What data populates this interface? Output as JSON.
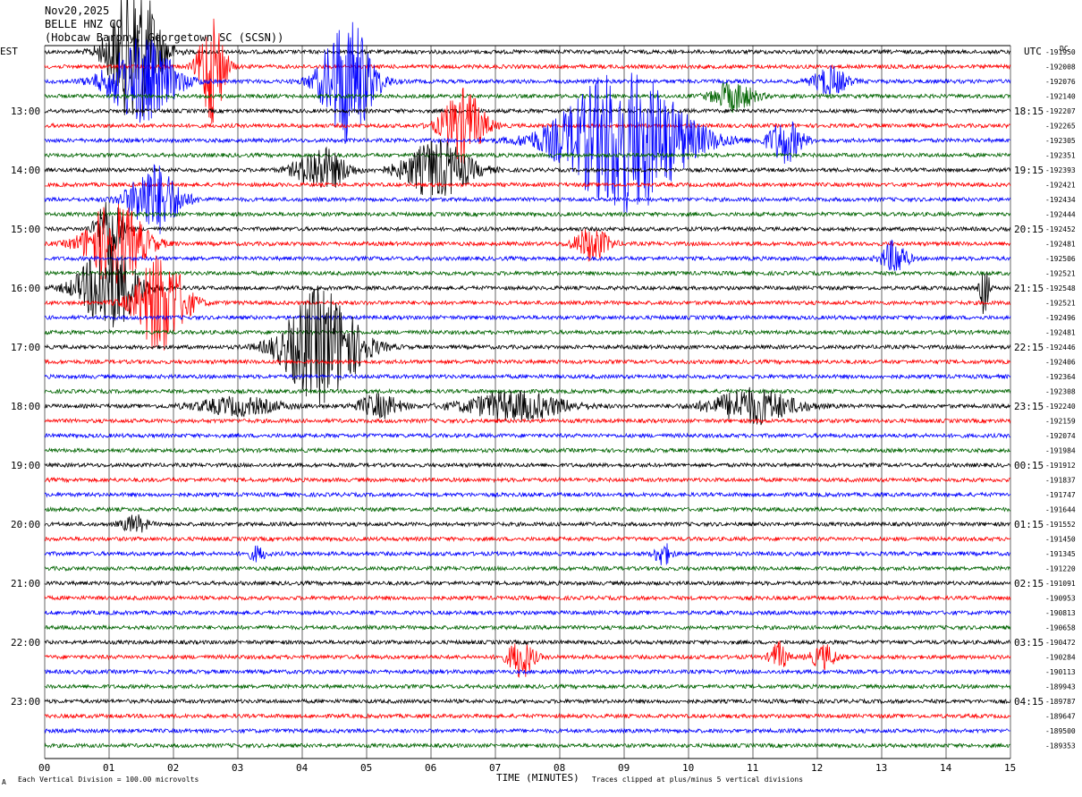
{
  "header": {
    "date": "Nov20,2025",
    "station": "BELLE HNZ CO",
    "location": "(Hobcaw Barony, Georgetown SC (SCSN))",
    "left_tz": "EST",
    "right_tz": "UTC",
    "dc_label": "DC"
  },
  "footer": {
    "scale_note": "Each Vertical Division =  100.00 microvolts",
    "clip_note": "Traces clipped at plus/minus 5 vertical divisions",
    "corner_mark": "A"
  },
  "chart_data": {
    "type": "line",
    "xlabel": "TIME (MINUTES)",
    "xlim": [
      0,
      15
    ],
    "x_ticks": [
      "00",
      "01",
      "02",
      "03",
      "04",
      "05",
      "06",
      "07",
      "08",
      "09",
      "10",
      "11",
      "12",
      "13",
      "14",
      "15"
    ],
    "trace_colors": [
      "#000000",
      "#ff0000",
      "#0000ff",
      "#006400"
    ],
    "trace_count": 48,
    "left_hour_labels": [
      "13:00",
      "14:00",
      "15:00",
      "16:00",
      "17:00",
      "18:00",
      "19:00",
      "20:00",
      "21:00",
      "22:00",
      "23:00"
    ],
    "right_hour_labels": [
      "18:15",
      "19:15",
      "20:15",
      "21:15",
      "22:15",
      "23:15",
      "00:15",
      "01:15",
      "02:15",
      "03:15",
      "04:15"
    ],
    "dc_offsets": [
      "-191950",
      "-192008",
      "-192076",
      "-192140",
      "-192207",
      "-192265",
      "-192305",
      "-192351",
      "-192393",
      "-192421",
      "-192434",
      "-192444",
      "-192452",
      "-192481",
      "-192506",
      "-192521",
      "-192548",
      "-192521",
      "-192496",
      "-192481",
      "-192446",
      "-192406",
      "-192364",
      "-192308",
      "-192240",
      "-192159",
      "-192074",
      "-191984",
      "-191912",
      "-191837",
      "-191747",
      "-191644",
      "-191552",
      "-191450",
      "-191345",
      "-191220",
      "-191091",
      "-190953",
      "-190813",
      "-190658",
      "-190472",
      "-190284",
      "-190113",
      "-189943",
      "-189787",
      "-189647",
      "-189500",
      "-189353"
    ],
    "events": [
      {
        "trace": 0,
        "minute": 1.4,
        "amp": 5.0,
        "dur": 0.6
      },
      {
        "trace": 1,
        "minute": 2.6,
        "amp": 4.0,
        "dur": 0.3
      },
      {
        "trace": 2,
        "minute": 1.5,
        "amp": 3.0,
        "dur": 0.8
      },
      {
        "trace": 2,
        "minute": 4.7,
        "amp": 4.5,
        "dur": 0.6
      },
      {
        "trace": 2,
        "minute": 12.2,
        "amp": 1.0,
        "dur": 0.4
      },
      {
        "trace": 3,
        "minute": 10.7,
        "amp": 1.0,
        "dur": 0.5
      },
      {
        "trace": 5,
        "minute": 6.5,
        "amp": 2.5,
        "dur": 0.5
      },
      {
        "trace": 6,
        "minute": 9.0,
        "amp": 5.0,
        "dur": 1.5
      },
      {
        "trace": 6,
        "minute": 11.5,
        "amp": 1.5,
        "dur": 0.4
      },
      {
        "trace": 8,
        "minute": 4.3,
        "amp": 1.5,
        "dur": 0.6
      },
      {
        "trace": 8,
        "minute": 6.1,
        "amp": 2.0,
        "dur": 0.8
      },
      {
        "trace": 10,
        "minute": 1.7,
        "amp": 2.5,
        "dur": 0.6
      },
      {
        "trace": 12,
        "minute": 1.0,
        "amp": 2.5,
        "dur": 0.3
      },
      {
        "trace": 13,
        "minute": 1.1,
        "amp": 3.0,
        "dur": 0.7
      },
      {
        "trace": 13,
        "minute": 8.5,
        "amp": 1.2,
        "dur": 0.4
      },
      {
        "trace": 14,
        "minute": 13.2,
        "amp": 1.2,
        "dur": 0.3
      },
      {
        "trace": 16,
        "minute": 1.0,
        "amp": 3.0,
        "dur": 0.7
      },
      {
        "trace": 16,
        "minute": 14.6,
        "amp": 2.0,
        "dur": 0.1
      },
      {
        "trace": 17,
        "minute": 1.8,
        "amp": 3.5,
        "dur": 0.6
      },
      {
        "trace": 20,
        "minute": 4.3,
        "amp": 4.0,
        "dur": 0.9
      },
      {
        "trace": 24,
        "minute": 3.0,
        "amp": 0.6,
        "dur": 1.0
      },
      {
        "trace": 24,
        "minute": 5.2,
        "amp": 0.8,
        "dur": 0.5
      },
      {
        "trace": 24,
        "minute": 7.3,
        "amp": 1.0,
        "dur": 1.2
      },
      {
        "trace": 24,
        "minute": 11.0,
        "amp": 1.2,
        "dur": 1.0
      },
      {
        "trace": 32,
        "minute": 1.4,
        "amp": 0.6,
        "dur": 0.3
      },
      {
        "trace": 34,
        "minute": 3.3,
        "amp": 0.5,
        "dur": 0.2
      },
      {
        "trace": 34,
        "minute": 9.6,
        "amp": 0.8,
        "dur": 0.2
      },
      {
        "trace": 41,
        "minute": 7.4,
        "amp": 1.4,
        "dur": 0.3
      },
      {
        "trace": 41,
        "minute": 11.4,
        "amp": 1.0,
        "dur": 0.2
      },
      {
        "trace": 41,
        "minute": 12.1,
        "amp": 0.8,
        "dur": 0.3
      }
    ]
  }
}
